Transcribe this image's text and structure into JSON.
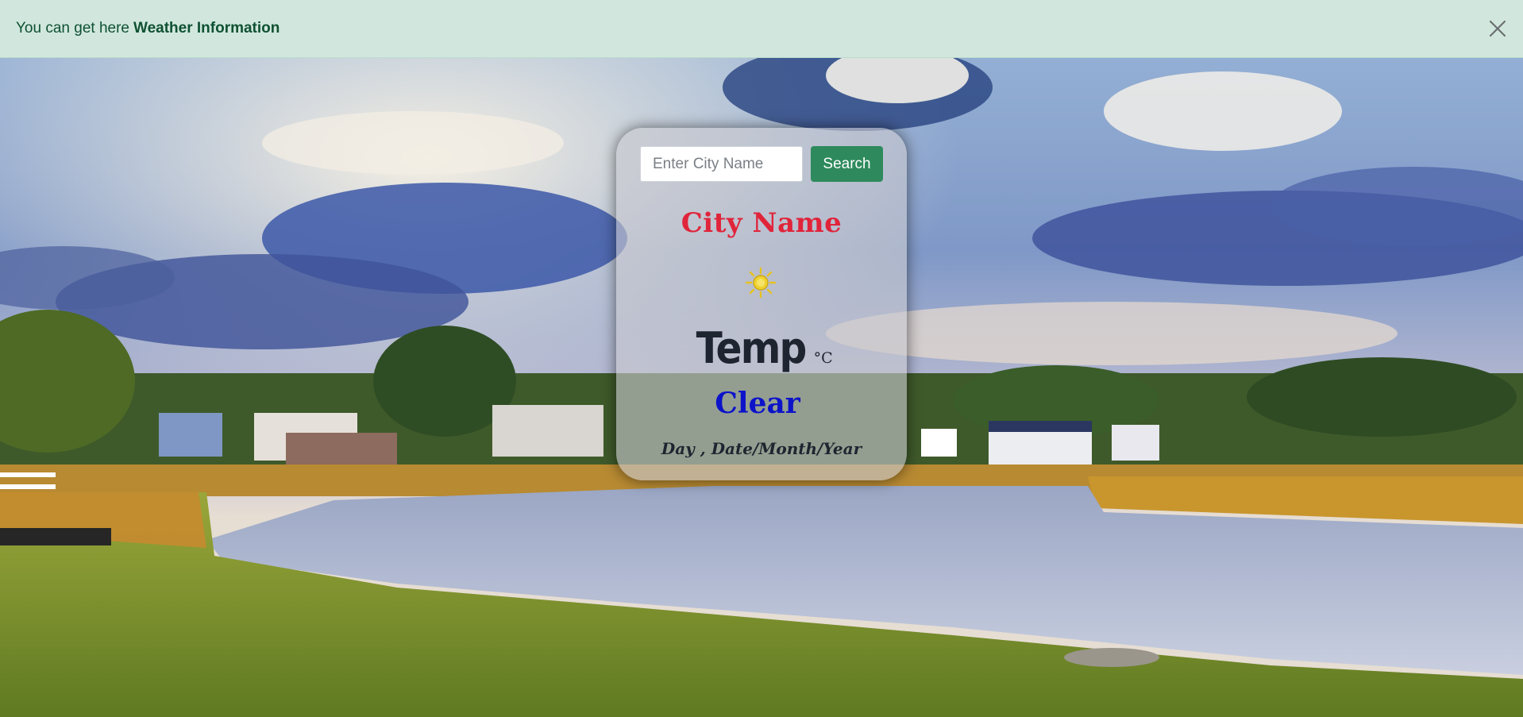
{
  "alert": {
    "text": "You can get here",
    "strong": "Weather Information",
    "close_icon": "close-icon",
    "colors": {
      "background": "#d1e7dd",
      "text": "#0f5132"
    }
  },
  "background": {
    "scene_icon": "landscape-photo"
  },
  "card": {
    "search": {
      "placeholder": "Enter City Name",
      "value": "",
      "button_label": "Search",
      "button_color": "#2e8a5c"
    },
    "city_name": "City Name",
    "city_color": "#e0243a",
    "weather_icon": "sun-icon",
    "temp": "Temp",
    "temp_unit": "°C",
    "condition": "Clear",
    "condition_color": "#0c13c9",
    "date_line": "Day , Date/Month/Year"
  }
}
